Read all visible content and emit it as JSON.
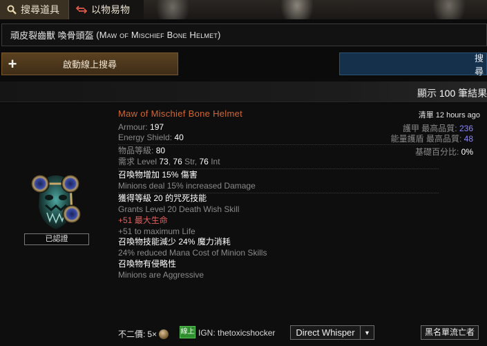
{
  "tabs": {
    "search_label": "搜尋道具",
    "exchange_label": "以物易物"
  },
  "search": {
    "item_name_zh": "頑皮裂齒獸 喚骨頭盔",
    "item_name_en": "(Maw of Mischief Bone Helmet)"
  },
  "buttons": {
    "live_search_label": "啟動線上搜尋",
    "search_label": "搜尋"
  },
  "results": {
    "count_prefix": "顯示",
    "count_value": "100",
    "count_suffix": "筆結果"
  },
  "item": {
    "name": "Maw of Mischief Bone Helmet",
    "armour_label": "Armour:",
    "armour_value": "197",
    "es_label": "Energy Shield:",
    "es_value": "40",
    "ilvl_label": "物品等級:",
    "ilvl_value": "80",
    "req_prefix": "需求 Level",
    "req_level": "73",
    "req_str": "76",
    "req_str_label": "Str,",
    "req_int": "76",
    "req_int_label": "Int",
    "verified_label": "已認證",
    "mods": [
      {
        "zh_a": "召喚物增加",
        "zh_num": "15%",
        "zh_b": "傷害",
        "en": "Minions deal 15% increased Damage"
      },
      {
        "zh_a": "獲得等級",
        "zh_num": "20",
        "zh_b": "的咒死技能",
        "en": "Grants Level 20 Death Wish Skill"
      },
      {
        "zh_red": "+51 最大生命",
        "en": "+51 to maximum Life"
      },
      {
        "zh_a": "召喚物技能減少",
        "zh_num": "24%",
        "zh_b": "魔力消耗",
        "en": "24% reduced Mana Cost of Minion Skills"
      },
      {
        "zh_a": "召喚物有侵略性",
        "en": "Minions are Aggressive"
      }
    ],
    "listed_label": "清單",
    "listed_time": "12 hours ago",
    "armour_max_label": "護甲 最高品質:",
    "armour_max_value": "236",
    "es_max_label": "能量護盾 最高品質:",
    "es_max_value": "48",
    "base_pct_label": "基礎百分比:",
    "base_pct_value": "0%"
  },
  "listing": {
    "price_label": "不二價:",
    "price_value": "5×",
    "currency_icon": "exalted-orb-icon",
    "online_label": "線上",
    "ign": "IGN: thetoxicshocker",
    "whisper_label": "Direct Whisper",
    "block_label": "黑名單流亡者"
  },
  "colors": {
    "unique_name": "#d1672f",
    "augmented": "#8a88ff",
    "life_mod": "#e06161",
    "online": "#2f8f2f",
    "live_button": "#4c3a1f",
    "search_button": "#15304b"
  }
}
